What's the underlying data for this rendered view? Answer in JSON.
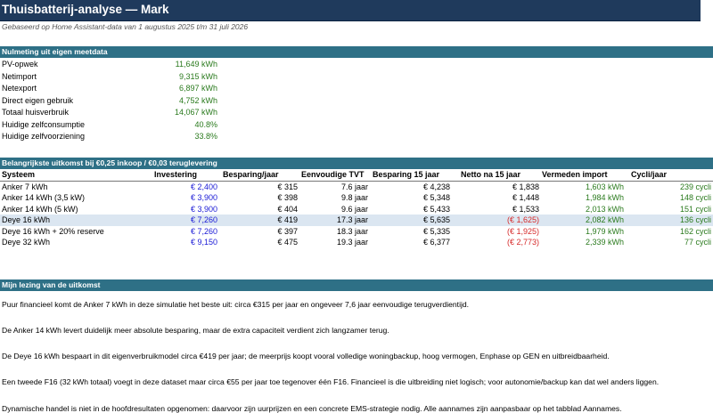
{
  "header": {
    "title": "Thuisbatterij-analyse — Mark",
    "subtitle": "Gebaseerd op Home Assistant-data van 1 augustus 2025 t/m 31 juli 2026"
  },
  "measurement": {
    "section_title": "Nulmeting uit eigen meetdata",
    "rows": [
      {
        "label": "PV-opwek",
        "value": "11,649 kWh"
      },
      {
        "label": "Netimport",
        "value": "9,315 kWh"
      },
      {
        "label": "Netexport",
        "value": "6,897 kWh"
      },
      {
        "label": "Direct eigen gebruik",
        "value": "4,752 kWh"
      },
      {
        "label": "Totaal huisverbruik",
        "value": "14,067 kWh"
      },
      {
        "label": "Huidige zelfconsumptie",
        "value": "40.8%"
      },
      {
        "label": "Huidige zelfvoorziening",
        "value": "33.8%"
      }
    ]
  },
  "results": {
    "section_title": "Belangrijkste uitkomst bij €0,25 inkoop / €0,03 teruglevering",
    "columns": [
      "Systeem",
      "Investering",
      "Besparing/jaar",
      "Eenvoudige TVT",
      "Besparing 15 jaar",
      "Netto na 15 jaar",
      "Vermeden import",
      "Cycli/jaar"
    ],
    "rows": [
      {
        "system": "Anker 7 kWh",
        "investment": "€ 2,400",
        "saving_year": "€ 315",
        "tvt": "7.6 jaar",
        "saving_15": "€ 4,238",
        "net_15": "€ 1,838",
        "net_negative": false,
        "avoided": "1,603 kWh",
        "cycles": "239 cycli",
        "highlight": false
      },
      {
        "system": "Anker 14 kWh (3,5 kW)",
        "investment": "€ 3,900",
        "saving_year": "€ 398",
        "tvt": "9.8 jaar",
        "saving_15": "€ 5,348",
        "net_15": "€ 1,448",
        "net_negative": false,
        "avoided": "1,984 kWh",
        "cycles": "148 cycli",
        "highlight": false
      },
      {
        "system": "Anker 14 kWh (5 kW)",
        "investment": "€ 3,900",
        "saving_year": "€ 404",
        "tvt": "9.6 jaar",
        "saving_15": "€ 5,433",
        "net_15": "€ 1,533",
        "net_negative": false,
        "avoided": "2,013 kWh",
        "cycles": "151 cycli",
        "highlight": false
      },
      {
        "system": "Deye 16 kWh",
        "investment": "€ 7,260",
        "saving_year": "€ 419",
        "tvt": "17.3 jaar",
        "saving_15": "€ 5,635",
        "net_15": "(€ 1,625)",
        "net_negative": true,
        "avoided": "2,082 kWh",
        "cycles": "136 cycli",
        "highlight": true
      },
      {
        "system": "Deye 16 kWh + 20% reserve",
        "investment": "€ 7,260",
        "saving_year": "€ 397",
        "tvt": "18.3 jaar",
        "saving_15": "€ 5,335",
        "net_15": "(€ 1,925)",
        "net_negative": true,
        "avoided": "1,979 kWh",
        "cycles": "162 cycli",
        "highlight": false
      },
      {
        "system": "Deye 32 kWh",
        "investment": "€ 9,150",
        "saving_year": "€ 475",
        "tvt": "19.3 jaar",
        "saving_15": "€ 6,377",
        "net_15": "(€ 2,773)",
        "net_negative": true,
        "avoided": "2,339 kWh",
        "cycles": "77 cycli",
        "highlight": false
      }
    ]
  },
  "interpretation": {
    "section_title": "Mijn lezing van de uitkomst",
    "paragraphs": [
      "Puur financieel komt de Anker 7 kWh in deze simulatie het beste uit: circa €315 per jaar en ongeveer 7,6 jaar eenvoudige terugverdientijd.",
      "De Anker 14 kWh levert duidelijk meer absolute besparing, maar de extra capaciteit verdient zich langzamer terug.",
      "De Deye 16 kWh bespaart in dit eigenverbruikmodel circa €419 per jaar; de meerprijs koopt vooral volledige woningbackup, hoog vermogen, Enphase op GEN en uitbreidbaarheid.",
      "Een tweede F16 (32 kWh totaal) voegt in deze dataset maar circa €55 per jaar toe tegenover één F16. Financieel is die uitbreiding niet logisch; voor autonomie/backup kan dat wel anders liggen.",
      "Dynamische handel is niet in de hoofdresultaten opgenomen: daarvoor zijn uurprijzen en een concrete EMS-strategie nodig. Alle aannames zijn aanpasbaar op het tabblad Aannames."
    ]
  },
  "colors": {
    "title_bg": "#1f3a5c",
    "section_bg": "#2e7086",
    "positive": "#2a7a1d",
    "negative": "#d62a2a",
    "investment": "#1a1ad6",
    "highlight_row": "#dbe6f1"
  }
}
